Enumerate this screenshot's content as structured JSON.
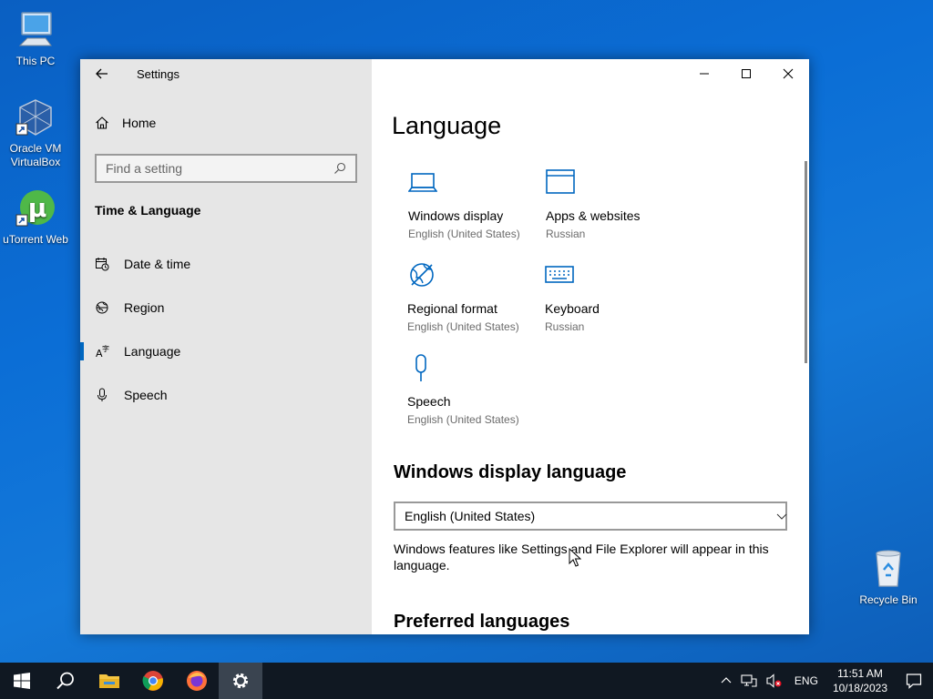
{
  "desktop": {
    "icons": [
      {
        "label": "This PC",
        "icon": "this-pc-icon"
      },
      {
        "label": "Oracle VM VirtualBox",
        "icon": "virtualbox-icon"
      },
      {
        "label": "uTorrent Web",
        "icon": "utorrent-icon"
      },
      {
        "label": "Recycle Bin",
        "icon": "recycle-bin-icon"
      }
    ]
  },
  "window": {
    "title": "Settings",
    "accent_color": "#0067c0"
  },
  "sidebar": {
    "home_label": "Home",
    "search_placeholder": "Find a setting",
    "section_title": "Time & Language",
    "items": [
      {
        "label": "Date & time",
        "icon": "calendar-clock-icon"
      },
      {
        "label": "Region",
        "icon": "region-globe-icon"
      },
      {
        "label": "Language",
        "icon": "language-icon",
        "active": true
      },
      {
        "label": "Speech",
        "icon": "microphone-icon"
      }
    ]
  },
  "main": {
    "heading": "Language",
    "tiles": [
      {
        "name": "Windows display",
        "value": "English (United States)",
        "icon": "laptop-icon"
      },
      {
        "name": "Apps & websites",
        "value": "Russian",
        "icon": "window-icon"
      },
      {
        "name": "Regional format",
        "value": "English (United States)",
        "icon": "regional-format-icon"
      },
      {
        "name": "Keyboard",
        "value": "Russian",
        "icon": "keyboard-icon"
      },
      {
        "name": "Speech",
        "value": "English (United States)",
        "icon": "microphone-icon"
      }
    ],
    "display_language_heading": "Windows display language",
    "display_language_value": "English (United States)",
    "display_language_desc": "Windows features like Settings and File Explorer will appear in this language.",
    "preferred_heading": "Preferred languages"
  },
  "taskbar": {
    "apps": [
      "start-icon",
      "search-icon",
      "file-explorer-icon",
      "chrome-icon",
      "firefox-icon",
      "settings-gear-icon"
    ],
    "tray": {
      "lang": "ENG",
      "time": "11:51 AM",
      "date": "10/18/2023"
    }
  }
}
